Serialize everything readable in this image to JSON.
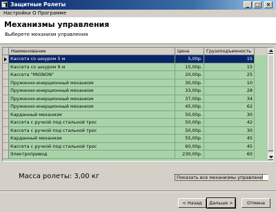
{
  "window": {
    "title": "Защитные Ролеты",
    "buttons": {
      "minimize": "_",
      "maximize": "□",
      "close": "×"
    }
  },
  "menu": [
    "Настройки",
    "О Программе"
  ],
  "header": {
    "title": "Механизмы управления",
    "subtitle": "Выберете механизм управления"
  },
  "table": {
    "columns": [
      "Наименование",
      "Цена",
      "Грузоподъемность"
    ],
    "selected_row": 0,
    "rows": [
      [
        "Кассета со шнуром 5 м",
        "5,00р.",
        "15"
      ],
      [
        "Кассета со шнуром 9 м",
        "15,00р.",
        "15"
      ],
      [
        "Кассета \"MIGNON\"",
        "20,00р.",
        "25"
      ],
      [
        "Пружинно-инерционный механизм",
        "30,00р.",
        "10"
      ],
      [
        "Пружинно-инерционный механизм",
        "33,00р.",
        "28"
      ],
      [
        "Пружинно-инерционный механизм",
        "37,00р.",
        "34"
      ],
      [
        "Пружинно-инерционный механизм",
        "45,00р.",
        "62"
      ],
      [
        "Карданный механизм",
        "50,00р.",
        "30"
      ],
      [
        "Кассета с ручкой под стальной трос",
        "50,00р.",
        "42"
      ],
      [
        "Кассета с ручкой под стальной трос",
        "50,00р.",
        "30"
      ],
      [
        "Карданный механизм",
        "55,00р.",
        "45"
      ],
      [
        "Кассета с ручкой под стальной трос",
        "60,00р.",
        "45"
      ],
      [
        "Электропривод",
        "230,00р.",
        "60"
      ]
    ]
  },
  "mass_label": "Масса ролеты: 3,00 кг",
  "show_all_label": "Показать все механизмы управления",
  "show_all_checked": false,
  "buttons": {
    "back": "< Назад",
    "next": "Дальше >",
    "cancel": "Отмена"
  },
  "colors": {
    "grid_bg": "#a9d3a9",
    "selection": "#0a246a",
    "titlebar": "#0a246a"
  }
}
